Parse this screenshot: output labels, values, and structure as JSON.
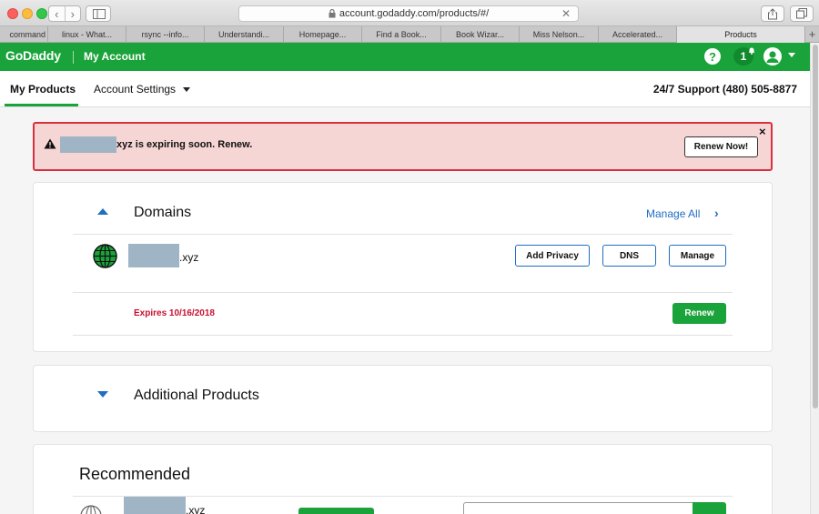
{
  "browser": {
    "url": "account.godaddy.com/products/#/",
    "tabs": [
      {
        "label": "command"
      },
      {
        "label": "linux - What..."
      },
      {
        "label": "rsync --info..."
      },
      {
        "label": "Understandi..."
      },
      {
        "label": "Homepage..."
      },
      {
        "label": "Find a Book..."
      },
      {
        "label": "Book Wizar..."
      },
      {
        "label": "Miss Nelson..."
      },
      {
        "label": "Accelerated..."
      },
      {
        "label": "Products"
      }
    ],
    "new_tab": "+"
  },
  "header": {
    "logo": "GoDaddy",
    "account": "My Account",
    "help": "?",
    "notifications": "1"
  },
  "subnav": {
    "my_products": "My Products",
    "account_settings": "Account Settings",
    "support": "24/7 Support (480) 505-8877"
  },
  "alert": {
    "message": "xyz is expiring soon. Renew.",
    "button": "Renew Now!",
    "close": "×"
  },
  "domains": {
    "title": "Domains",
    "manage_all": "Manage All",
    "domain_tld": ".xyz",
    "add_privacy": "Add Privacy",
    "dns": "DNS",
    "manage": "Manage",
    "expires": "Expires 10/16/2018",
    "renew": "Renew"
  },
  "additional": {
    "title": "Additional Products"
  },
  "recommended": {
    "title": "Recommended",
    "domain_tld": ".xyz"
  },
  "colors": {
    "brand_green": "#1aa33a",
    "link_blue": "#1e6ec2",
    "alert_bg": "#f6d6d5",
    "alert_border": "#d9303f",
    "expire_red": "#c8102e"
  }
}
